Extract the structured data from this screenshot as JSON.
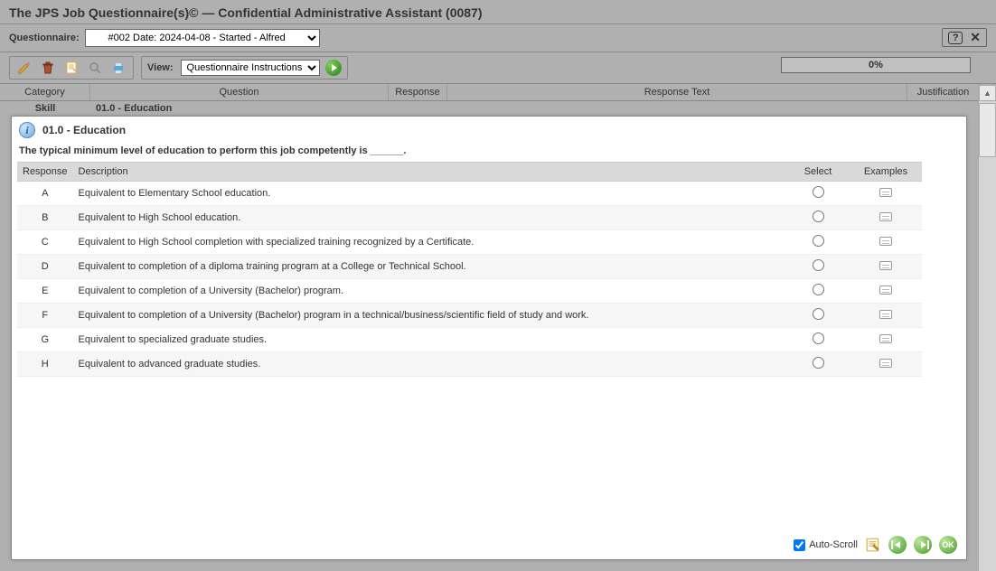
{
  "title": "The JPS Job Questionnaire(s)© — Confidential Administrative Assistant (0087)",
  "selector": {
    "label": "Questionnaire:",
    "value": "#002 Date: 2024-04-08 - Started - Alfred"
  },
  "toolbar": {
    "view_label": "View:",
    "view_value": "Questionnaire Instructions",
    "progress": "0%"
  },
  "grid": {
    "headers": {
      "category": "Category",
      "question": "Question",
      "response": "Response",
      "response_text": "Response Text",
      "justification": "Justification"
    },
    "row": {
      "category": "Skill",
      "question": "01.0 - Education"
    }
  },
  "dialog": {
    "heading": "01.0 - Education",
    "prompt": "The typical minimum level of education to perform this job competently is ______.",
    "columns": {
      "response": "Response",
      "description": "Description",
      "select": "Select",
      "examples": "Examples"
    },
    "responses": [
      {
        "code": "A",
        "desc": "Equivalent to Elementary School education."
      },
      {
        "code": "B",
        "desc": "Equivalent to High School education."
      },
      {
        "code": "C",
        "desc": "Equivalent to High School completion with specialized training recognized by a Certificate."
      },
      {
        "code": "D",
        "desc": "Equivalent to completion of a diploma training program at a College or Technical School."
      },
      {
        "code": "E",
        "desc": "Equivalent to completion of a University (Bachelor) program."
      },
      {
        "code": "F",
        "desc": "Equivalent to completion of a University (Bachelor) program in a technical/business/scientific field of study and work."
      },
      {
        "code": "G",
        "desc": "Equivalent to specialized graduate studies."
      },
      {
        "code": "H",
        "desc": "Equivalent to advanced graduate studies."
      }
    ],
    "footer": {
      "auto_scroll": "Auto-Scroll",
      "ok": "OK"
    }
  }
}
